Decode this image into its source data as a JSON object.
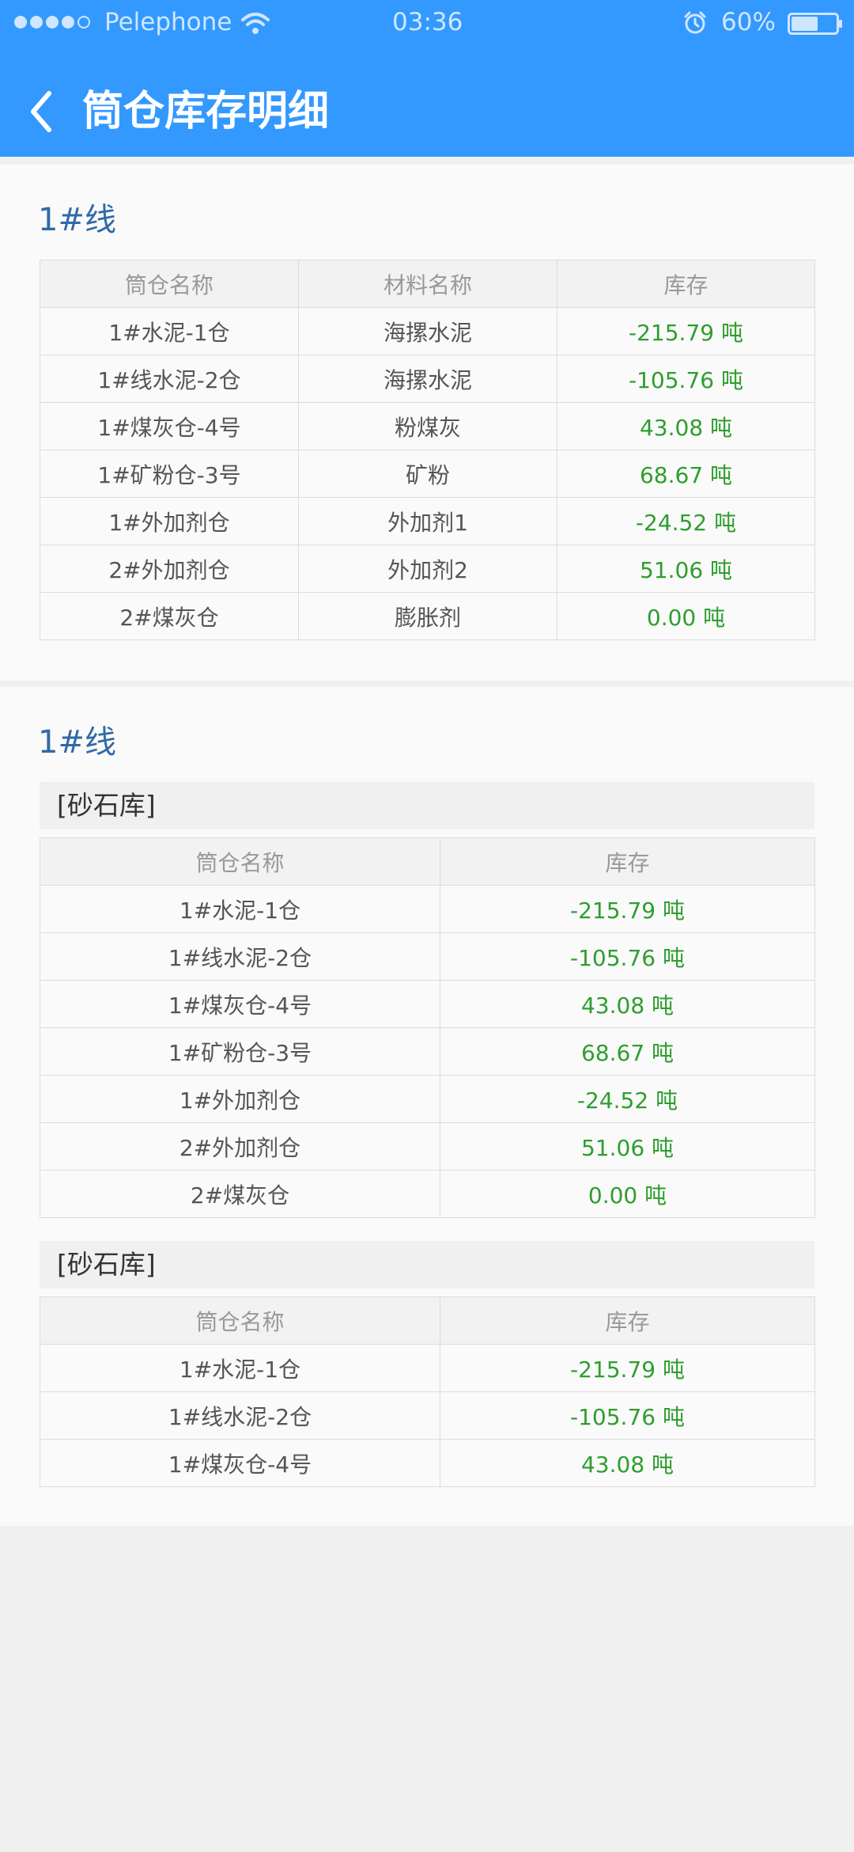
{
  "status_bar": {
    "carrier": "Pelephone",
    "time": "03:36",
    "battery": "60%",
    "battery_level": 0.6,
    "signal_bars": 4,
    "signal_total": 5
  },
  "header": {
    "title": "筒仓库存明细"
  },
  "colors": {
    "accent": "#3399ff",
    "title_blue": "#2f6aa8",
    "stock_green": "#2e9e2e"
  },
  "sections": [
    {
      "title": "1#线",
      "columns": [
        "筒仓名称",
        "材料名称",
        "库存"
      ],
      "rows": [
        [
          "1#水泥-1仓",
          "海摞水泥",
          "-215.79 吨"
        ],
        [
          "1#线水泥-2仓",
          "海摞水泥",
          "-105.76 吨"
        ],
        [
          "1#煤灰仓-4号",
          "粉煤灰",
          "43.08 吨"
        ],
        [
          "1#矿粉仓-3号",
          "矿粉",
          "68.67 吨"
        ],
        [
          "1#外加剂仓",
          "外加剂1",
          "-24.52 吨"
        ],
        [
          "2#外加剂仓",
          "外加剂2",
          "51.06 吨"
        ],
        [
          "2#煤灰仓",
          "膨胀剂",
          "0.00 吨"
        ]
      ]
    },
    {
      "title": "1#线",
      "groups": [
        {
          "name": "[砂石库]",
          "columns": [
            "筒仓名称",
            "库存"
          ],
          "rows": [
            [
              "1#水泥-1仓",
              "-215.79 吨"
            ],
            [
              "1#线水泥-2仓",
              "-105.76 吨"
            ],
            [
              "1#煤灰仓-4号",
              "43.08 吨"
            ],
            [
              "1#矿粉仓-3号",
              "68.67 吨"
            ],
            [
              "1#外加剂仓",
              "-24.52 吨"
            ],
            [
              "2#外加剂仓",
              "51.06 吨"
            ],
            [
              "2#煤灰仓",
              "0.00 吨"
            ]
          ]
        },
        {
          "name": "[砂石库]",
          "columns": [
            "筒仓名称",
            "库存"
          ],
          "rows": [
            [
              "1#水泥-1仓",
              "-215.79 吨"
            ],
            [
              "1#线水泥-2仓",
              "-105.76 吨"
            ],
            [
              "1#煤灰仓-4号",
              "43.08 吨"
            ]
          ]
        }
      ]
    }
  ]
}
